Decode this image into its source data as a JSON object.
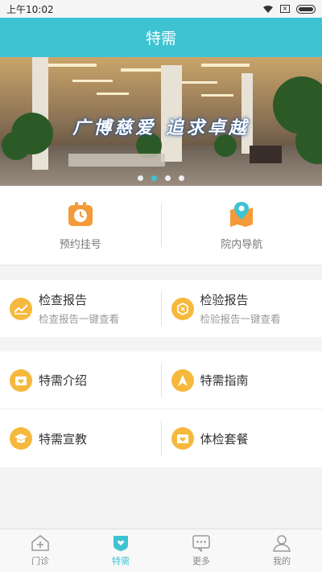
{
  "status_bar": {
    "time": "上午10:02"
  },
  "header": {
    "title": "特需"
  },
  "banner": {
    "slogan": "广博慈爱  追求卓越",
    "slide_count": 4,
    "active_slide": 2
  },
  "quick_actions": [
    {
      "label": "预约挂号",
      "icon": "calendar-clock-icon"
    },
    {
      "label": "院内导航",
      "icon": "map-pin-icon"
    }
  ],
  "reports": [
    {
      "title": "检查报告",
      "subtitle": "检查报告一键查看",
      "icon": "chart-line-icon"
    },
    {
      "title": "检验报告",
      "subtitle": "检验报告一键查看",
      "icon": "hexagon-icon"
    }
  ],
  "services": [
    {
      "title": "特需介绍",
      "icon": "heart-card-icon"
    },
    {
      "title": "特需指南",
      "icon": "navigation-arrow-icon"
    },
    {
      "title": "特需宣教",
      "icon": "graduation-cap-icon"
    },
    {
      "title": "体检套餐",
      "icon": "heart-card-icon"
    }
  ],
  "tabbar": [
    {
      "label": "门诊",
      "icon": "clinic-house-icon"
    },
    {
      "label": "特需",
      "icon": "shield-heart-icon",
      "active": true
    },
    {
      "label": "更多",
      "icon": "more-chat-icon"
    },
    {
      "label": "我的",
      "icon": "person-icon"
    }
  ],
  "colors": {
    "primary": "#3ec3d3",
    "accent": "#f6b93d",
    "icon_orange": "#f59a3a"
  }
}
